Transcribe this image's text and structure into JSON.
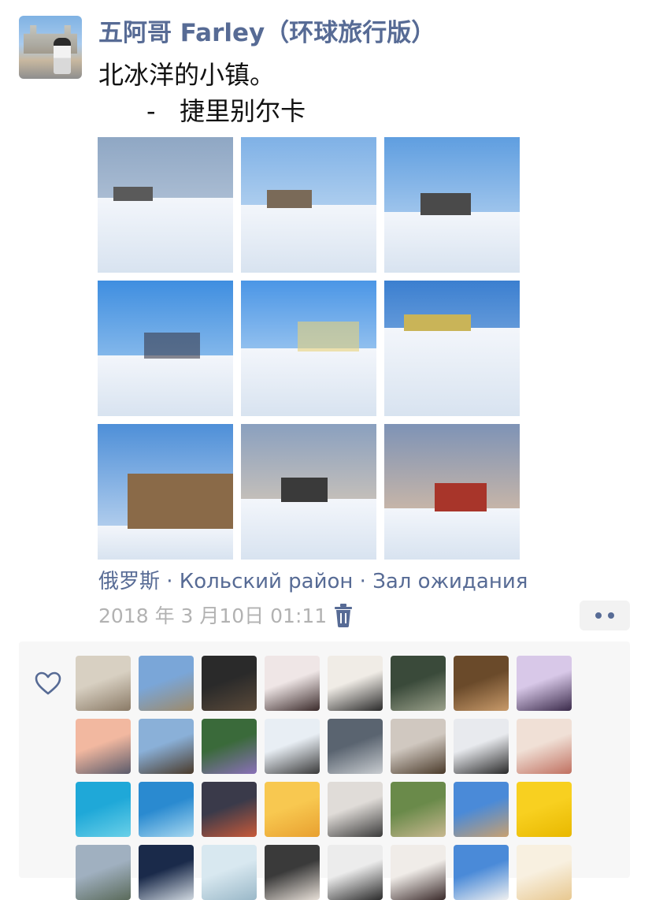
{
  "post": {
    "author": "五阿哥 Farley（环球旅行版）",
    "text_line1": "北冰洋的小镇。",
    "text_line2": "      -   捷里别尔卡",
    "location": "俄罗斯 · Кольский район · Зал ожидания",
    "timestamp": "2018 年 3 月10日 01:11"
  },
  "photos": [
    {
      "name": "photo-harbor",
      "sky": "#8fa7c4",
      "sky2": "#c9d5e4",
      "snow_top": 0.45
    },
    {
      "name": "photo-village-road",
      "sky": "#7fb1e6",
      "sky2": "#d8e8f6",
      "snow_top": 0.5
    },
    {
      "name": "photo-snowy-houses",
      "sky": "#5f9ee0",
      "sky2": "#cfe2f5",
      "snow_top": 0.55
    },
    {
      "name": "photo-power-line",
      "sky": "#3f8ee0",
      "sky2": "#b9d8f3",
      "snow_top": 0.55
    },
    {
      "name": "photo-shadow-field",
      "sky": "#4b96e6",
      "sky2": "#d6e8f7",
      "snow_top": 0.5
    },
    {
      "name": "photo-buried-car",
      "sky": "#3b7fd0",
      "sky2": "#a9c8ea",
      "snow_top": 0.35
    },
    {
      "name": "photo-wooden-barn",
      "sky": "#4e8fd8",
      "sky2": "#cfe0f3",
      "snow_top": 0.75
    },
    {
      "name": "photo-sunset-hills",
      "sky": "#8aa0bf",
      "sky2": "#f1d7b6",
      "snow_top": 0.55
    },
    {
      "name": "photo-red-house",
      "sky": "#7e93b6",
      "sky2": "#f1c9a0",
      "snow_top": 0.62
    }
  ],
  "likes": {
    "avatars": [
      {
        "c1": "#d8d0c2",
        "c2": "#8a7a66"
      },
      {
        "c1": "#7aa6d8",
        "c2": "#9d8a6a"
      },
      {
        "c1": "#2a2a2a",
        "c2": "#5a4a3a"
      },
      {
        "c1": "#efe6e6",
        "c2": "#3a2a2a"
      },
      {
        "c1": "#f0ece6",
        "c2": "#2a2a2a"
      },
      {
        "c1": "#3a4a3a",
        "c2": "#9aa08a"
      },
      {
        "c1": "#6a4a2a",
        "c2": "#c89a6a"
      },
      {
        "c1": "#d8c8e8",
        "c2": "#3a2a4a"
      },
      {
        "c1": "#f2b8a0",
        "c2": "#5a5a6a"
      },
      {
        "c1": "#8ab0d8",
        "c2": "#4a3a2a"
      },
      {
        "c1": "#3a6a3a",
        "c2": "#8a70b8"
      },
      {
        "c1": "#e8eef4",
        "c2": "#3a3a3a"
      },
      {
        "c1": "#5a6470",
        "c2": "#c8ccd0"
      },
      {
        "c1": "#d0c8c0",
        "c2": "#4a3a2a"
      },
      {
        "c1": "#e8eaee",
        "c2": "#2a2a2a"
      },
      {
        "c1": "#f0e0d6",
        "c2": "#c07060"
      },
      {
        "c1": "#1fa8d8",
        "c2": "#6ad0e8"
      },
      {
        "c1": "#2a8ad0",
        "c2": "#a8d8f0"
      },
      {
        "c1": "#3a3a4a",
        "c2": "#c85a3a"
      },
      {
        "c1": "#f8c850",
        "c2": "#e8a030"
      },
      {
        "c1": "#e0dcd8",
        "c2": "#3a3a3a"
      },
      {
        "c1": "#6a8a4a",
        "c2": "#c8b890"
      },
      {
        "c1": "#4a8ad8",
        "c2": "#c8a070"
      },
      {
        "c1": "#f8d020",
        "c2": "#e8b800"
      },
      {
        "c1": "#a0b0c0",
        "c2": "#5a6a5a"
      },
      {
        "c1": "#1a2a4a",
        "c2": "#d0d8e0"
      },
      {
        "c1": "#d8e8f0",
        "c2": "#9ab8c8"
      },
      {
        "c1": "#3a3a3a",
        "c2": "#e8e0d8"
      },
      {
        "c1": "#ececec",
        "c2": "#2a2a2a"
      },
      {
        "c1": "#f0ece8",
        "c2": "#3a2a2a"
      },
      {
        "c1": "#4a8ad8",
        "c2": "#f0f0f0"
      },
      {
        "c1": "#f8f0e0",
        "c2": "#e8c890"
      }
    ]
  },
  "icons": {
    "trash": "trash-icon",
    "more": "more-dots-icon",
    "like": "heart-icon"
  },
  "colors": {
    "link": "#576b95",
    "timestamp": "#b2b2b2",
    "panel": "#f7f7f7"
  }
}
